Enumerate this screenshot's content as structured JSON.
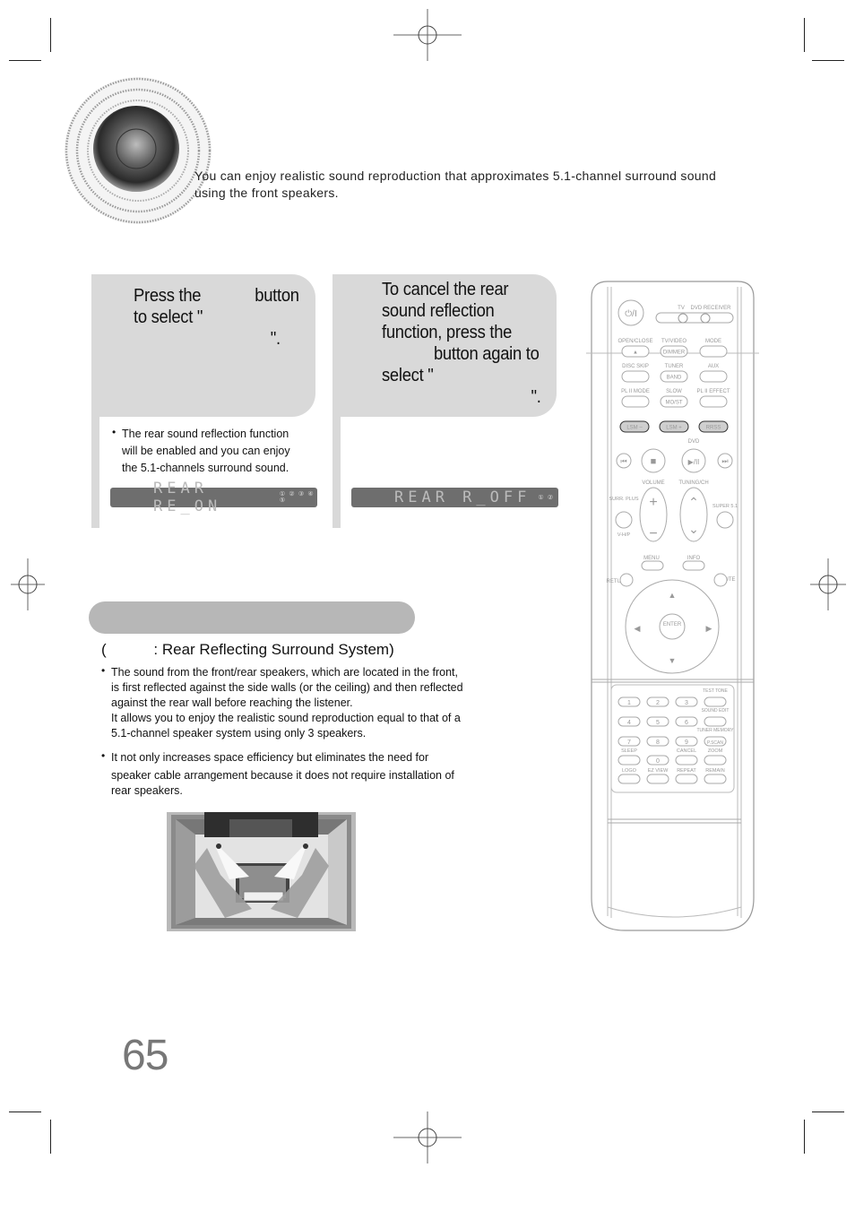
{
  "header": {
    "intro_text": "You can enjoy realistic sound reproduction that approximates 5.1-channel surround sound using the front speakers."
  },
  "steps": [
    {
      "instruction_part1": "Press the",
      "instruction_part2": "button",
      "instruction_part3": "to select \"",
      "instruction_part4": "\".",
      "note": "The rear sound reflection function will be enabled and you can enjoy the 5.1-channels surround sound.",
      "lcd_text": "REAR RE_ON",
      "lcd_icons": "① ② ③  ④ ⑤"
    },
    {
      "instruction_line1": "To cancel the rear",
      "instruction_line2": "sound reflection",
      "instruction_line3": "function, press the",
      "instruction_line4": "button again to",
      "instruction_line5": "select \"",
      "instruction_line6": "\".",
      "lcd_text": "REAR R_OFF",
      "lcd_icons": "① ②"
    }
  ],
  "section": {
    "subheading_open": "(",
    "subheading_rest": ": Rear Reflecting Surround System)",
    "bullets": [
      {
        "lines": [
          "The sound from the front/rear speakers, which are located in the front,",
          "is first reflected against the side walls (or the ceiling) and then reflected",
          "against the rear wall before reaching the listener.",
          "It allows you to enjoy the realistic sound reproduction equal to that of a",
          "5.1-channel speaker system using only 3 speakers."
        ]
      },
      {
        "lines": [
          "It not only increases space efficiency but eliminates the need for",
          "speaker cable arrangement because it does not require installation of",
          "rear speakers."
        ]
      }
    ],
    "bullet_glyph": "•"
  },
  "page_number": "65",
  "remote": {
    "power": "⏻/I",
    "mode_labels": [
      "TV",
      "DVD RECEIVER"
    ],
    "row1_labels": [
      "OPEN/CLOSE",
      "TV/VIDEO",
      "MODE"
    ],
    "row1_buttons": [
      "▲",
      "DIMMER",
      ""
    ],
    "row2_labels": [
      "DISC SKIP",
      "TUNER",
      "AUX"
    ],
    "row2_buttons": [
      "",
      "BAND",
      ""
    ],
    "row3_labels": [
      "PL II MODE",
      "SLOW",
      "PL II EFFECT"
    ],
    "row3_buttons": [
      "",
      "MO/ST",
      ""
    ],
    "lsm_buttons": [
      "LSM –",
      "LSM +",
      "RRSS"
    ],
    "dvd_label": "DVD",
    "volume_label": "VOLUME",
    "tuning_label": "TUNING/CH",
    "surr_plus_label": "SURR. PLUS",
    "vhp_label": "V-H/P",
    "super51_label": "SUPER 5.1",
    "menu_label": "MENU",
    "info_label": "INFO",
    "return_label": "RETURN",
    "mute_label": "MUTE",
    "enter_label": "ENTER",
    "keypad": [
      "1",
      "2",
      "3",
      "4",
      "5",
      "6",
      "7",
      "8",
      "9",
      "0"
    ],
    "side_labels": [
      "TEST TONE",
      "SOUND EDIT",
      "TUNER MEMORY",
      "ZOOM"
    ],
    "bottom_labels": [
      "SLEEP",
      "CANCEL",
      "LOGO",
      "EZ VIEW",
      "REPEAT",
      "REMAIN"
    ],
    "pscan": "P.SCAN"
  }
}
